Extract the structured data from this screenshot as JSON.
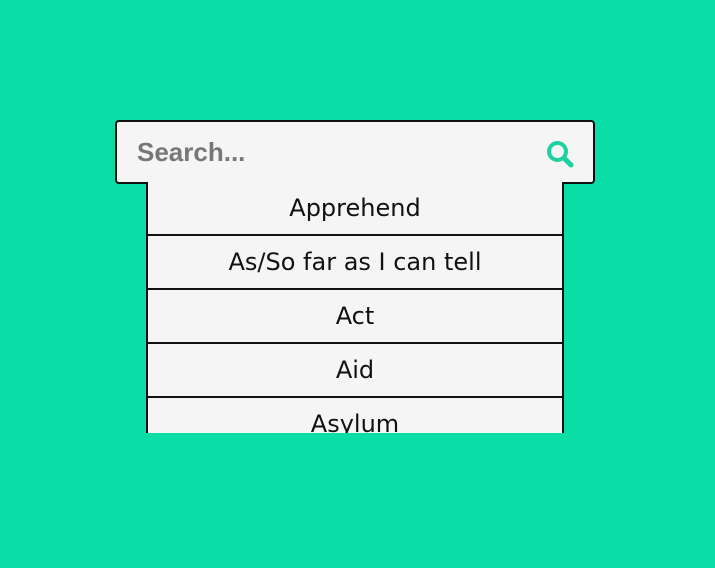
{
  "search": {
    "placeholder": "Search...",
    "value": "",
    "icon": "search-icon"
  },
  "colors": {
    "background": "#0ADDA5",
    "accent": "#1DD1A1",
    "panel": "#F5F5F5",
    "border": "#111111"
  },
  "results": [
    {
      "label": "Apprehend"
    },
    {
      "label": "As/So far as I can tell"
    },
    {
      "label": "Act"
    },
    {
      "label": "Aid"
    },
    {
      "label": "Asylum"
    }
  ]
}
